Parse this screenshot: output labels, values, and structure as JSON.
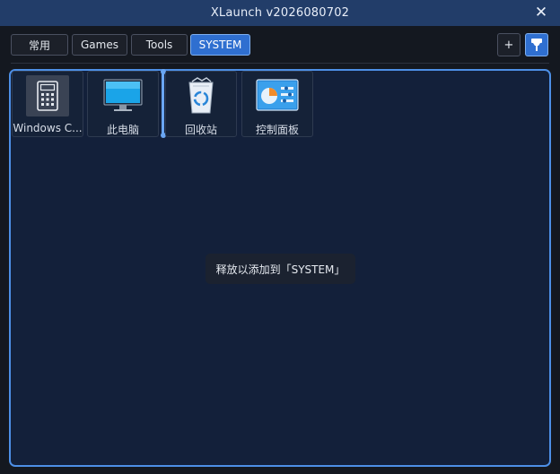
{
  "window": {
    "title": "XLaunch v2026080702"
  },
  "tabs": [
    {
      "label": "常用",
      "active": false
    },
    {
      "label": "Games",
      "active": false
    },
    {
      "label": "Tools",
      "active": false
    },
    {
      "label": "SYSTEM",
      "active": true
    }
  ],
  "toolbar": {
    "add_label": "+",
    "pin_icon": "pin-icon"
  },
  "items": [
    {
      "label": "Windows C...",
      "icon": "calculator-icon"
    },
    {
      "label": "此电脑",
      "icon": "monitor-icon"
    },
    {
      "label": "回收站",
      "icon": "recycle-bin-icon"
    },
    {
      "label": "控制面板",
      "icon": "control-panel-icon"
    }
  ],
  "toast": {
    "text": "释放以添加到「SYSTEM」"
  },
  "colors": {
    "accent": "#2f6fd0",
    "titlebar": "#223d69",
    "panel_border": "#4d8fe6"
  }
}
